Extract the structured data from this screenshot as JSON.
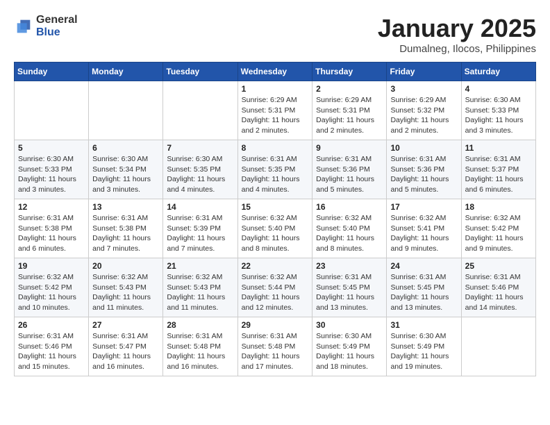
{
  "logo": {
    "general": "General",
    "blue": "Blue"
  },
  "title": "January 2025",
  "subtitle": "Dumalneg, Ilocos, Philippines",
  "days_of_week": [
    "Sunday",
    "Monday",
    "Tuesday",
    "Wednesday",
    "Thursday",
    "Friday",
    "Saturday"
  ],
  "weeks": [
    [
      {
        "day": "",
        "info": ""
      },
      {
        "day": "",
        "info": ""
      },
      {
        "day": "",
        "info": ""
      },
      {
        "day": "1",
        "info": "Sunrise: 6:29 AM\nSunset: 5:31 PM\nDaylight: 11 hours and 2 minutes."
      },
      {
        "day": "2",
        "info": "Sunrise: 6:29 AM\nSunset: 5:31 PM\nDaylight: 11 hours and 2 minutes."
      },
      {
        "day": "3",
        "info": "Sunrise: 6:29 AM\nSunset: 5:32 PM\nDaylight: 11 hours and 2 minutes."
      },
      {
        "day": "4",
        "info": "Sunrise: 6:30 AM\nSunset: 5:33 PM\nDaylight: 11 hours and 3 minutes."
      }
    ],
    [
      {
        "day": "5",
        "info": "Sunrise: 6:30 AM\nSunset: 5:33 PM\nDaylight: 11 hours and 3 minutes."
      },
      {
        "day": "6",
        "info": "Sunrise: 6:30 AM\nSunset: 5:34 PM\nDaylight: 11 hours and 3 minutes."
      },
      {
        "day": "7",
        "info": "Sunrise: 6:30 AM\nSunset: 5:35 PM\nDaylight: 11 hours and 4 minutes."
      },
      {
        "day": "8",
        "info": "Sunrise: 6:31 AM\nSunset: 5:35 PM\nDaylight: 11 hours and 4 minutes."
      },
      {
        "day": "9",
        "info": "Sunrise: 6:31 AM\nSunset: 5:36 PM\nDaylight: 11 hours and 5 minutes."
      },
      {
        "day": "10",
        "info": "Sunrise: 6:31 AM\nSunset: 5:36 PM\nDaylight: 11 hours and 5 minutes."
      },
      {
        "day": "11",
        "info": "Sunrise: 6:31 AM\nSunset: 5:37 PM\nDaylight: 11 hours and 6 minutes."
      }
    ],
    [
      {
        "day": "12",
        "info": "Sunrise: 6:31 AM\nSunset: 5:38 PM\nDaylight: 11 hours and 6 minutes."
      },
      {
        "day": "13",
        "info": "Sunrise: 6:31 AM\nSunset: 5:38 PM\nDaylight: 11 hours and 7 minutes."
      },
      {
        "day": "14",
        "info": "Sunrise: 6:31 AM\nSunset: 5:39 PM\nDaylight: 11 hours and 7 minutes."
      },
      {
        "day": "15",
        "info": "Sunrise: 6:32 AM\nSunset: 5:40 PM\nDaylight: 11 hours and 8 minutes."
      },
      {
        "day": "16",
        "info": "Sunrise: 6:32 AM\nSunset: 5:40 PM\nDaylight: 11 hours and 8 minutes."
      },
      {
        "day": "17",
        "info": "Sunrise: 6:32 AM\nSunset: 5:41 PM\nDaylight: 11 hours and 9 minutes."
      },
      {
        "day": "18",
        "info": "Sunrise: 6:32 AM\nSunset: 5:42 PM\nDaylight: 11 hours and 9 minutes."
      }
    ],
    [
      {
        "day": "19",
        "info": "Sunrise: 6:32 AM\nSunset: 5:42 PM\nDaylight: 11 hours and 10 minutes."
      },
      {
        "day": "20",
        "info": "Sunrise: 6:32 AM\nSunset: 5:43 PM\nDaylight: 11 hours and 11 minutes."
      },
      {
        "day": "21",
        "info": "Sunrise: 6:32 AM\nSunset: 5:43 PM\nDaylight: 11 hours and 11 minutes."
      },
      {
        "day": "22",
        "info": "Sunrise: 6:32 AM\nSunset: 5:44 PM\nDaylight: 11 hours and 12 minutes."
      },
      {
        "day": "23",
        "info": "Sunrise: 6:31 AM\nSunset: 5:45 PM\nDaylight: 11 hours and 13 minutes."
      },
      {
        "day": "24",
        "info": "Sunrise: 6:31 AM\nSunset: 5:45 PM\nDaylight: 11 hours and 13 minutes."
      },
      {
        "day": "25",
        "info": "Sunrise: 6:31 AM\nSunset: 5:46 PM\nDaylight: 11 hours and 14 minutes."
      }
    ],
    [
      {
        "day": "26",
        "info": "Sunrise: 6:31 AM\nSunset: 5:46 PM\nDaylight: 11 hours and 15 minutes."
      },
      {
        "day": "27",
        "info": "Sunrise: 6:31 AM\nSunset: 5:47 PM\nDaylight: 11 hours and 16 minutes."
      },
      {
        "day": "28",
        "info": "Sunrise: 6:31 AM\nSunset: 5:48 PM\nDaylight: 11 hours and 16 minutes."
      },
      {
        "day": "29",
        "info": "Sunrise: 6:31 AM\nSunset: 5:48 PM\nDaylight: 11 hours and 17 minutes."
      },
      {
        "day": "30",
        "info": "Sunrise: 6:30 AM\nSunset: 5:49 PM\nDaylight: 11 hours and 18 minutes."
      },
      {
        "day": "31",
        "info": "Sunrise: 6:30 AM\nSunset: 5:49 PM\nDaylight: 11 hours and 19 minutes."
      },
      {
        "day": "",
        "info": ""
      }
    ]
  ]
}
